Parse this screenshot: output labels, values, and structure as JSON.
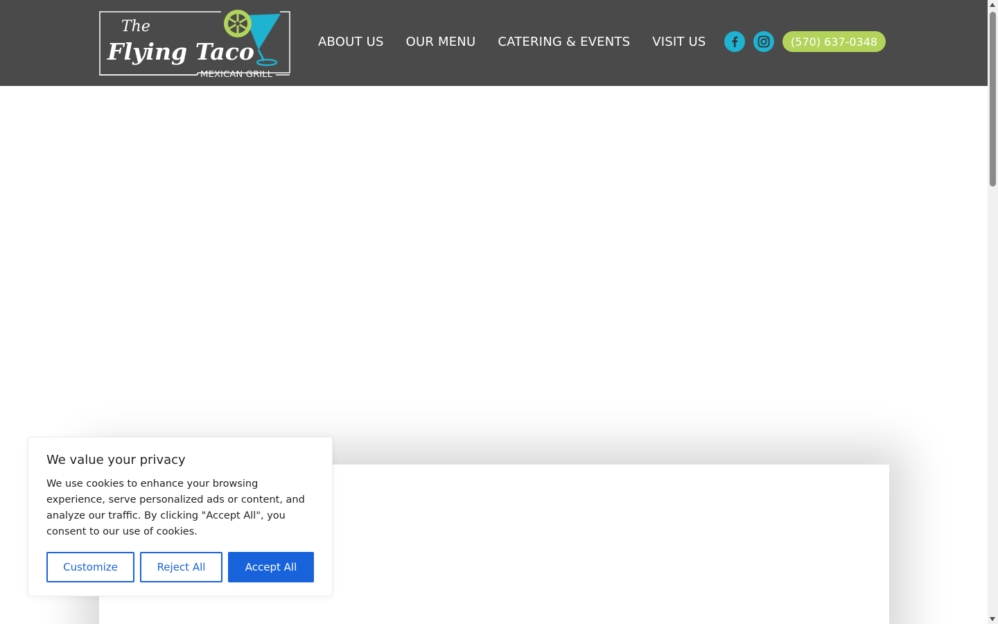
{
  "header": {
    "logo": {
      "line1": "The",
      "line2": "Flying Taco",
      "line3": "MEXICAN GRILL"
    },
    "nav": [
      {
        "label": "ABOUT US"
      },
      {
        "label": "OUR MENU"
      },
      {
        "label": "CATERING & EVENTS"
      },
      {
        "label": "VISIT US"
      }
    ],
    "social": [
      {
        "icon": "facebook-icon"
      },
      {
        "icon": "instagram-icon"
      }
    ],
    "phone": "(570) 637-0348"
  },
  "cookie": {
    "title": "We value your privacy",
    "text": "We use cookies to enhance your browsing experience, serve personalized ads or content, and analyze our traffic. By clicking \"Accept All\", you consent to our use of cookies.",
    "customize_label": "Customize",
    "reject_label": "Reject All",
    "accept_label": "Accept All"
  },
  "colors": {
    "header_bg": "#4a4a4a",
    "accent_blue": "#1eb3d1",
    "accent_green": "#b3d45a",
    "cookie_blue": "#1863dc"
  }
}
